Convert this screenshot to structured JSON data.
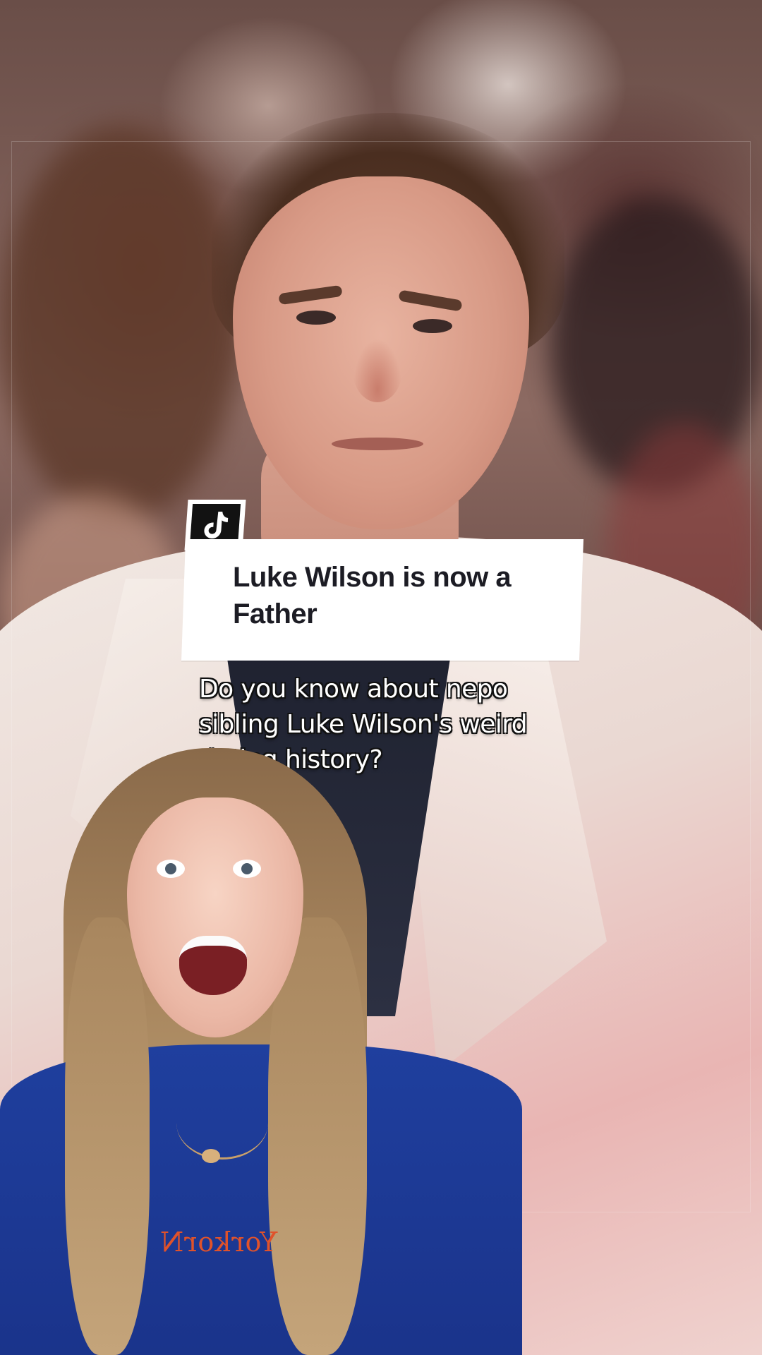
{
  "overlay": {
    "title": "Luke Wilson is now a Father",
    "caption": "Do you know about nepo\nsibling Luke Wilson's weird\ndating history?",
    "sweater_text": "YorkorN",
    "brand_icon": "tiktok-icon"
  },
  "colors": {
    "card_background": "#ffffff",
    "title_text": "#1c1c24",
    "caption_text": "#ffffff",
    "badge_background": "#121212"
  }
}
